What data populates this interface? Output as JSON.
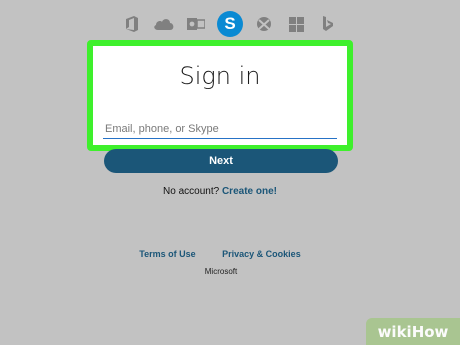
{
  "app_bar": {
    "icons": [
      "office-icon",
      "onedrive-icon",
      "outlook-icon",
      "skype-icon",
      "xbox-icon",
      "windows-icon",
      "bing-icon"
    ],
    "skype_letter": "S",
    "active_color": "#0a8ad3"
  },
  "signin": {
    "title": "Sign in",
    "email_placeholder": "Email, phone, or Skype",
    "next_label": "Next",
    "highlight_color": "#3ef02c"
  },
  "signup": {
    "prompt": "No account?",
    "link_label": "Create one!"
  },
  "footer": {
    "terms_label": "Terms of Use",
    "privacy_label": "Privacy & Cookies",
    "brand": "Microsoft"
  },
  "watermark": {
    "text": "wikiHow"
  }
}
